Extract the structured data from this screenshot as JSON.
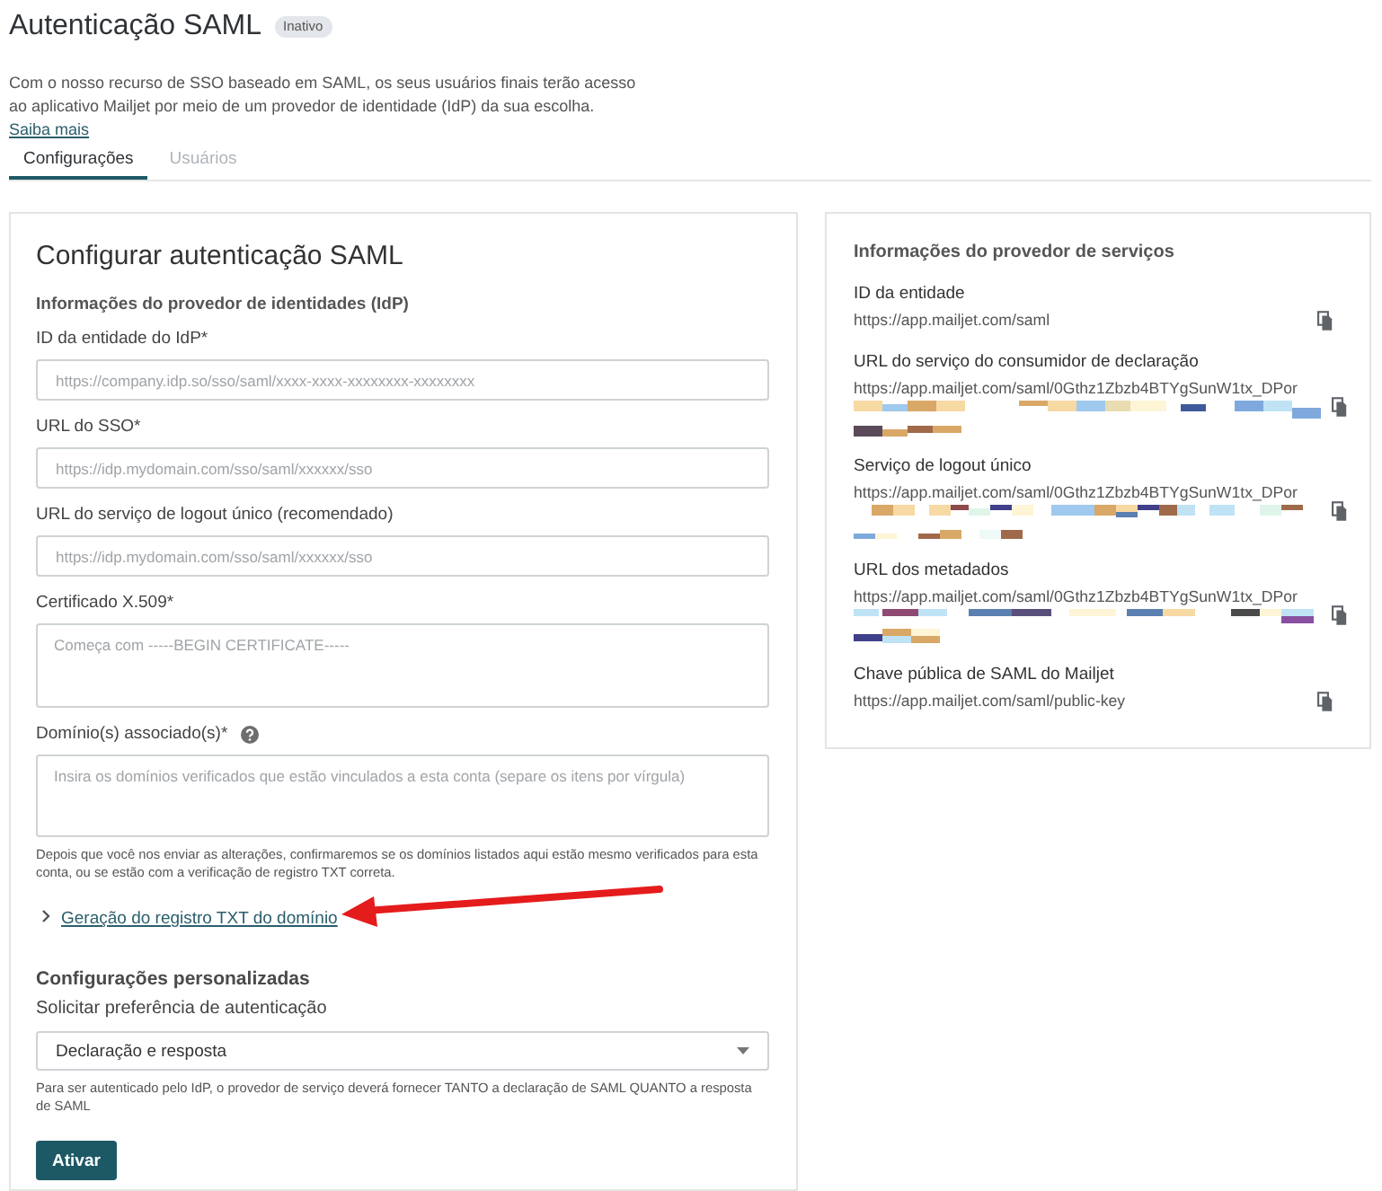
{
  "header": {
    "title": "Autenticação SAML",
    "status_badge": "Inativo",
    "description": "Com o nosso recurso de SSO baseado em SAML, os seus usuários finais terão acesso ao aplicativo Mailjet por meio de um provedor de identidade (IdP) da sua escolha.",
    "learn_more_link": "Saiba mais"
  },
  "tabs": [
    {
      "label": "Configurações",
      "selected": true
    },
    {
      "label": "Usuários",
      "selected": false
    }
  ],
  "config_form": {
    "title": "Configurar autenticação SAML",
    "idp_section_title": "Informações do provedor de identidades (IdP)",
    "fields": [
      {
        "kind": "input",
        "label": "ID da entidade do IdP*",
        "placeholder": "https://company.idp.so/sso/saml/xxxx-xxxx-xxxxxxxx-xxxxxxxx"
      },
      {
        "kind": "input",
        "label": "URL do SSO*",
        "placeholder": "https://idp.mydomain.com/sso/saml/xxxxxx/sso"
      },
      {
        "kind": "input",
        "label": "URL do serviço de logout único (recomendado)",
        "placeholder": "https://idp.mydomain.com/sso/saml/xxxxxx/sso"
      },
      {
        "kind": "textarea",
        "label": "Certificado X.509*",
        "placeholder": "Começa com -----BEGIN CERTIFICATE-----"
      },
      {
        "kind": "textarea",
        "label": "Domínio(s) associado(s)*",
        "help_icon": true,
        "placeholder": "Insira os domínios verificados que estão vinculados a esta conta (separe os itens por vírgula)",
        "hint": "Depois que você nos enviar as alterações, confirmaremos se os domínios listados aqui estão mesmo verificados para esta conta, ou se estão com a verificação de registro TXT correta."
      }
    ],
    "txt_record_link": {
      "label": "Geração do registro TXT do domínio",
      "pointed_at_by_arrow": true
    },
    "custom_section_title": "Configurações personalizadas",
    "auth_preference": {
      "label": "Solicitar preferência de autenticação",
      "value": "Declaração e resposta",
      "hint": "Para ser autenticado pelo IdP, o provedor de serviço deverá fornecer TANTO a declaração de SAML QUANTO a resposta de SAML"
    },
    "submit_button": "Ativar"
  },
  "service_provider": {
    "title": "Informações do provedor de serviços",
    "items": [
      {
        "label": "ID da entidade",
        "value": "https://app.mailjet.com/saml",
        "redacted": false
      },
      {
        "label": "URL do serviço do consumidor de declaração",
        "value": "https://app.mailjet.com/saml/0Gthz1Zbzb4BTYgSunW1tx_DPor",
        "redacted": true
      },
      {
        "label": "Serviço de logout único",
        "value": "https://app.mailjet.com/saml/0Gthz1Zbzb4BTYgSunW1tx_DPor",
        "redacted": true
      },
      {
        "label": "URL dos metadados",
        "value": "https://app.mailjet.com/saml/0Gthz1Zbzb4BTYgSunW1tx_DPor",
        "redacted": true
      },
      {
        "label": "Chave pública de SAML do Mailjet",
        "value": "https://app.mailjet.com/saml/public-key",
        "redacted": false
      }
    ]
  }
}
